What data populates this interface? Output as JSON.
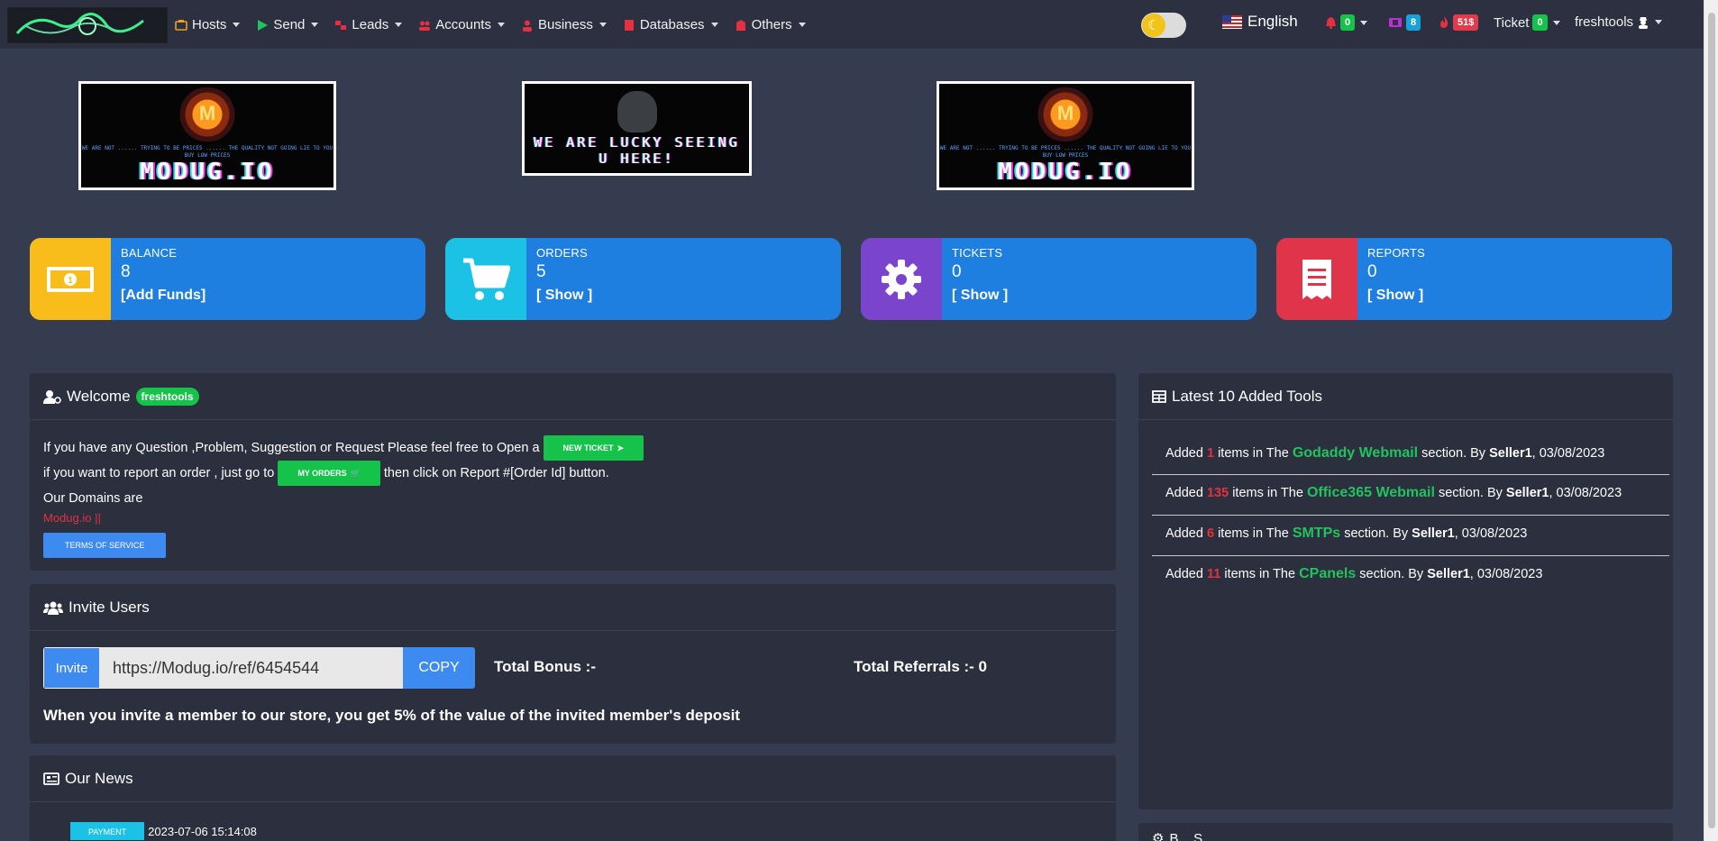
{
  "nav": {
    "menu": [
      {
        "label": "Hosts",
        "icon": "hosts-icon",
        "color": "#f0a020"
      },
      {
        "label": "Send",
        "icon": "send-icon",
        "color": "#22c35e"
      },
      {
        "label": "Leads",
        "icon": "leads-icon",
        "color": "#e5303f"
      },
      {
        "label": "Accounts",
        "icon": "accounts-icon",
        "color": "#e5303f"
      },
      {
        "label": "Business",
        "icon": "business-icon",
        "color": "#e5303f"
      },
      {
        "label": "Databases",
        "icon": "databases-icon",
        "color": "#e5303f"
      },
      {
        "label": "Others",
        "icon": "others-icon",
        "color": "#e5303f"
      }
    ],
    "language": "English",
    "notifications_count": "0",
    "messages_count": "8",
    "fire_amount": "51$",
    "ticket_label": "Ticket",
    "ticket_count": "0",
    "username": "freshtools"
  },
  "banners": {
    "left_title": "MODUG.IO",
    "left_sub": "WE ARE NOT ...... TRYING TO BE PRICES ...... THE QUALITY NOT GOING LIE TO YOU BUY LOW PRICES",
    "center_text": "WE ARE LUCKY SEEING U HERE!",
    "right_title": "MODUG.IO",
    "right_sub": "WE ARE NOT ...... TRYING TO BE PRICES ...... THE QUALITY NOT GOING LIE TO YOU BUY LOW PRICES"
  },
  "stats": [
    {
      "label": "BALANCE",
      "value": "8",
      "link": "[Add Funds]",
      "icon_bg": "#f8bd1b"
    },
    {
      "label": "ORDERS",
      "value": "5",
      "link": "[ Show ]",
      "icon_bg": "#1bc2e6"
    },
    {
      "label": "TICKETS",
      "value": "0",
      "link": "[ Show ]",
      "icon_bg": "#7a45cc"
    },
    {
      "label": "REPORTS",
      "value": "0",
      "link": "[ Show ]",
      "icon_bg": "#e0344a"
    }
  ],
  "welcome": {
    "title": "Welcome",
    "username": "freshtools",
    "line1": "If you have any Question ,Problem, Suggestion or Request Please feel free to Open a",
    "new_ticket_btn": "NEW TICKET",
    "line2_a": "if you want to report an order , just go to",
    "my_orders_btn": "MY ORDERS",
    "line2_b": "then click on Report #[Order Id] button.",
    "domains_label": "Our Domains are",
    "domain_link": "Modug.io ||",
    "tos_btn": "TERMS OF SERVICE"
  },
  "invite": {
    "title": "Invite Users",
    "label": "Invite",
    "url": "https://Modug.io/ref/6454544",
    "copy_btn": "COPY",
    "total_bonus": "Total Bonus :-",
    "total_referrals": "Total Referrals :- 0",
    "note": "When you invite a member to our store, you get 5% of the value of the invited member's deposit"
  },
  "news": {
    "title": "Our News",
    "items": [
      {
        "badge": "PAYMENT",
        "date": "2023-07-06 15:14:08"
      }
    ]
  },
  "latest": {
    "title": "Latest 10 Added Tools",
    "items": [
      {
        "prefix": "Added",
        "count": "1",
        "mid": "items in The",
        "section": "Godaddy Webmail",
        "suffix": "section. By",
        "seller": "Seller1",
        "date": ", 03/08/2023"
      },
      {
        "prefix": "Added",
        "count": "135",
        "mid": "items in The",
        "section": "Office365 Webmail",
        "suffix": "section. By",
        "seller": "Seller1",
        "date": ", 03/08/2023"
      },
      {
        "prefix": "Added",
        "count": "6",
        "mid": "items in The",
        "section": "SMTPs",
        "suffix": "section. By",
        "seller": "Seller1",
        "date": ", 03/08/2023"
      },
      {
        "prefix": "Added",
        "count": "11",
        "mid": "items in The",
        "section": "CPanels",
        "suffix": "section. By",
        "seller": "Seller1",
        "date": ", 03/08/2023"
      }
    ]
  },
  "bottom_right_title": "B... S..."
}
